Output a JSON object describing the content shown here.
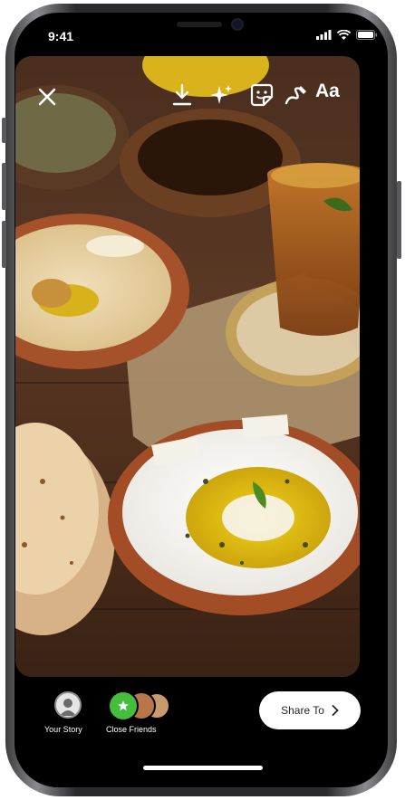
{
  "status_bar": {
    "time": "9:41"
  },
  "toolbar": {
    "close_icon": "close-icon",
    "download_icon": "download-icon",
    "effects_icon": "sparkle-icon",
    "sticker_icon": "sticker-icon",
    "draw_icon": "draw-icon",
    "text_label": "Aa"
  },
  "bottom_bar": {
    "your_story_label": "Your Story",
    "close_friends_label": "Close Friends",
    "share_label": "Share To",
    "colors": {
      "close_friends_green": "#45bd3d",
      "share_bg": "#ffffff"
    }
  }
}
